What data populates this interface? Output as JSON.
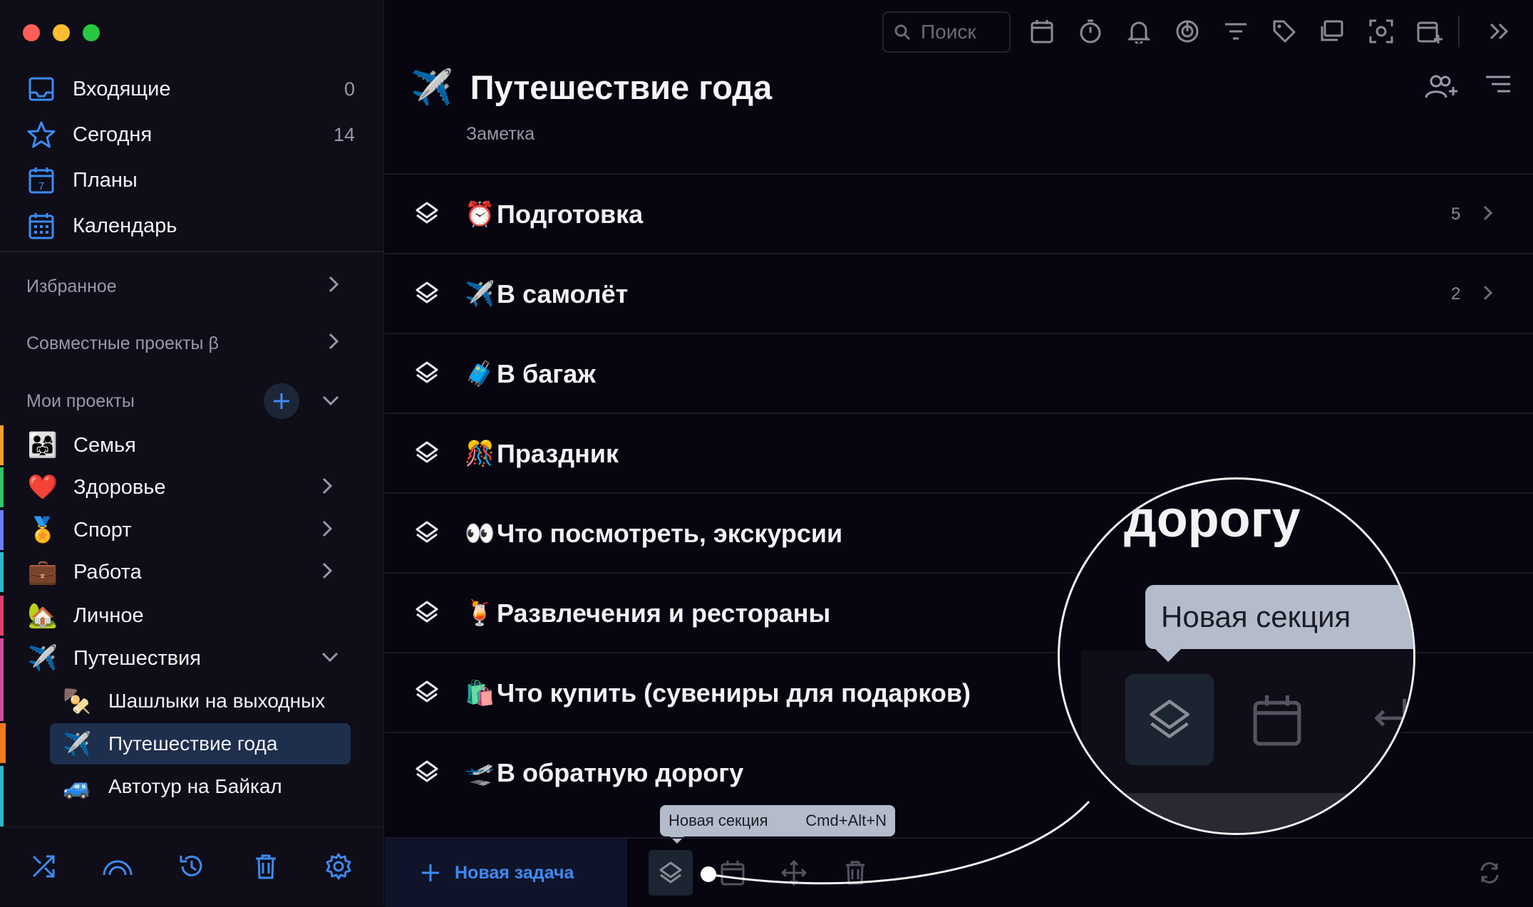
{
  "sidebar": {
    "nav": [
      {
        "label": "Входящие",
        "count": "0",
        "icon": "inbox-icon"
      },
      {
        "label": "Сегодня",
        "count": "14",
        "icon": "star-icon"
      },
      {
        "label": "Планы",
        "count": "",
        "icon": "calendar-7-icon"
      },
      {
        "label": "Календарь",
        "count": "",
        "icon": "calendar-grid-icon"
      }
    ],
    "favorites_label": "Избранное",
    "shared_label": "Совместные проекты β",
    "my_projects_label": "Мои проекты",
    "projects": [
      {
        "emoji": "👨‍👩‍👧",
        "label": "Семья",
        "color": "#f0a030"
      },
      {
        "emoji": "❤️",
        "label": "Здоровье",
        "color": "#31c26b"
      },
      {
        "emoji": "🏅",
        "label": "Спорт",
        "color": "#6b7cff"
      },
      {
        "emoji": "💼",
        "label": "Работа",
        "color": "#2bb8c8"
      },
      {
        "emoji": "🏡",
        "label": "Личное",
        "color": "#e04070"
      },
      {
        "emoji": "✈️",
        "label": "Путешествия",
        "color": "#d04fa0"
      }
    ],
    "subprojects": [
      {
        "emoji": "🍢",
        "label": "Шашлыки на выходных"
      },
      {
        "emoji": "✈️",
        "label": "Путешествие года"
      },
      {
        "emoji": "🚙",
        "label": "Автотур на Байкал"
      }
    ]
  },
  "toolbar": {
    "search_placeholder": "Поиск"
  },
  "header": {
    "emoji": "✈️",
    "title": "Путешествие года",
    "subtitle": "Заметка"
  },
  "sections": [
    {
      "emoji": "⏰",
      "label": "Подготовка",
      "count": "5"
    },
    {
      "emoji": "✈️",
      "label": "В самолёт",
      "count": "2"
    },
    {
      "emoji": "🧳",
      "label": "В багаж",
      "count": ""
    },
    {
      "emoji": "🎊",
      "label": "Праздник",
      "count": ""
    },
    {
      "emoji": "👀",
      "label": "Что посмотреть, экскурсии",
      "count": ""
    },
    {
      "emoji": "🍹",
      "label": "Развлечения и рестораны",
      "count": ""
    },
    {
      "emoji": "🛍️",
      "label": "Что купить (сувениры для подарков)",
      "count": ""
    },
    {
      "emoji": "🛫",
      "label": "В обратную дорогу",
      "count": ""
    }
  ],
  "footer": {
    "new_task": "Новая задача",
    "tooltip_label": "Новая секция",
    "tooltip_shortcut": "Cmd+Alt+N"
  },
  "magnifier": {
    "word": "дорогу",
    "tooltip": "Новая секция"
  },
  "colors": {
    "accent": "#3d8bf2",
    "traffic_red": "#fe5f57",
    "traffic_yellow": "#febc2e",
    "traffic_green": "#28c840"
  }
}
